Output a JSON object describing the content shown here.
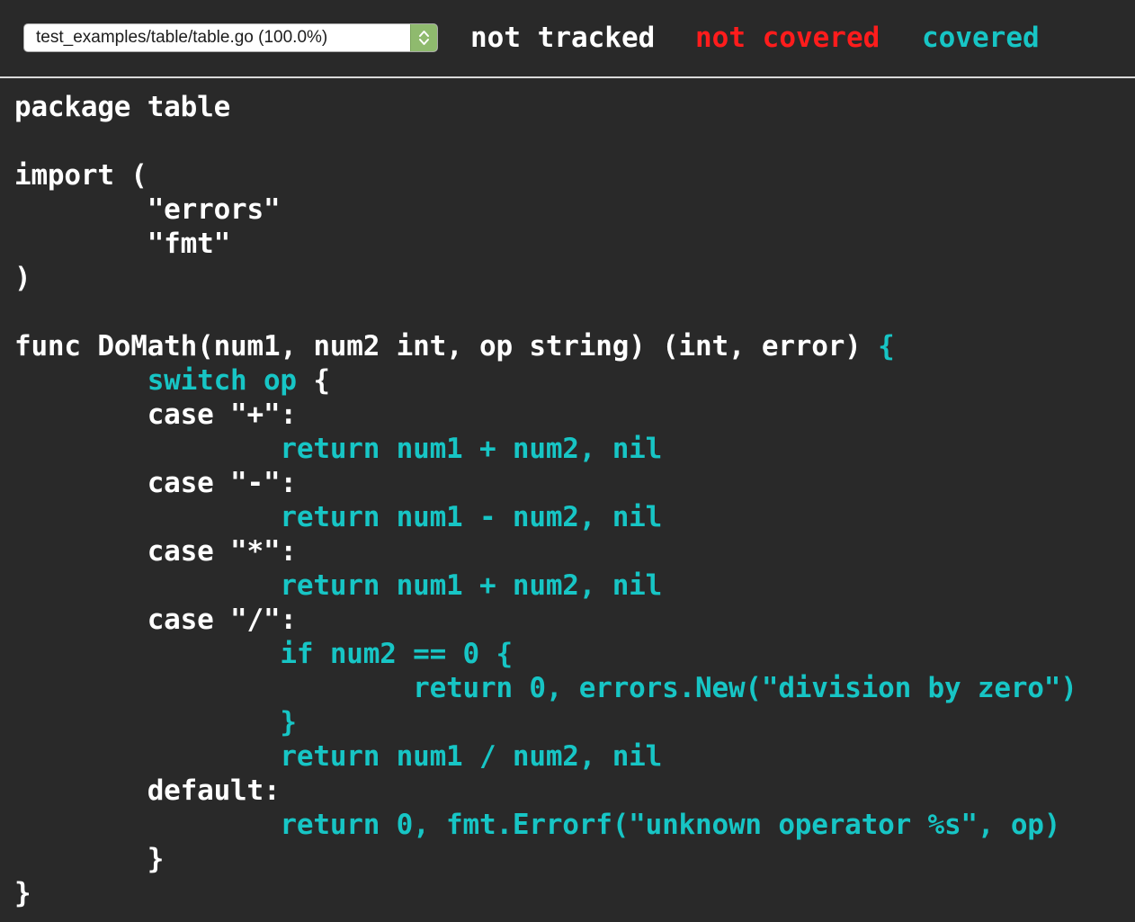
{
  "colors": {
    "background": "#292929",
    "not_tracked": "#ffffff",
    "not_covered": "#ff1c1c",
    "covered": "#17c5c5",
    "divider": "#d9d9d9",
    "select_stepper": "#8fba6e"
  },
  "topbar": {
    "file_select": {
      "selected": "test_examples/table/table.go (100.0%)",
      "icon": "up-down-chevron-icon"
    },
    "legend": {
      "not_tracked": "not tracked",
      "not_covered": "not covered",
      "covered": "covered"
    }
  },
  "source": {
    "lines": [
      {
        "segments": [
          {
            "text": "package table",
            "status": "not_tracked"
          }
        ]
      },
      {
        "segments": [
          {
            "text": "",
            "status": "not_tracked"
          }
        ]
      },
      {
        "segments": [
          {
            "text": "import (",
            "status": "not_tracked"
          }
        ]
      },
      {
        "segments": [
          {
            "text": "        \"errors\"",
            "status": "not_tracked"
          }
        ]
      },
      {
        "segments": [
          {
            "text": "        \"fmt\"",
            "status": "not_tracked"
          }
        ]
      },
      {
        "segments": [
          {
            "text": ")",
            "status": "not_tracked"
          }
        ]
      },
      {
        "segments": [
          {
            "text": "",
            "status": "not_tracked"
          }
        ]
      },
      {
        "segments": [
          {
            "text": "func DoMath(num1, num2 int, op string) (int, error) ",
            "status": "not_tracked"
          },
          {
            "text": "{",
            "status": "covered"
          }
        ]
      },
      {
        "segments": [
          {
            "text": "        ",
            "status": "not_tracked"
          },
          {
            "text": "switch op",
            "status": "covered"
          },
          {
            "text": " {",
            "status": "not_tracked"
          }
        ]
      },
      {
        "segments": [
          {
            "text": "        case \"+\":",
            "status": "not_tracked"
          }
        ]
      },
      {
        "segments": [
          {
            "text": "                ",
            "status": "not_tracked"
          },
          {
            "text": "return num1 + num2, nil",
            "status": "covered"
          }
        ]
      },
      {
        "segments": [
          {
            "text": "        case \"-\":",
            "status": "not_tracked"
          }
        ]
      },
      {
        "segments": [
          {
            "text": "                ",
            "status": "not_tracked"
          },
          {
            "text": "return num1 - num2, nil",
            "status": "covered"
          }
        ]
      },
      {
        "segments": [
          {
            "text": "        case \"*\":",
            "status": "not_tracked"
          }
        ]
      },
      {
        "segments": [
          {
            "text": "                ",
            "status": "not_tracked"
          },
          {
            "text": "return num1 + num2, nil",
            "status": "covered"
          }
        ]
      },
      {
        "segments": [
          {
            "text": "        case \"/\":",
            "status": "not_tracked"
          }
        ]
      },
      {
        "segments": [
          {
            "text": "                ",
            "status": "not_tracked"
          },
          {
            "text": "if num2 == 0 {",
            "status": "covered"
          }
        ]
      },
      {
        "segments": [
          {
            "text": "                        ",
            "status": "not_tracked"
          },
          {
            "text": "return 0, errors.New(\"division by zero\")",
            "status": "covered"
          }
        ]
      },
      {
        "segments": [
          {
            "text": "                ",
            "status": "not_tracked"
          },
          {
            "text": "}",
            "status": "covered"
          }
        ]
      },
      {
        "segments": [
          {
            "text": "                ",
            "status": "not_tracked"
          },
          {
            "text": "return num1 / num2, nil",
            "status": "covered"
          }
        ]
      },
      {
        "segments": [
          {
            "text": "        default:",
            "status": "not_tracked"
          }
        ]
      },
      {
        "segments": [
          {
            "text": "                ",
            "status": "not_tracked"
          },
          {
            "text": "return 0, fmt.Errorf(\"unknown operator %s\", op)",
            "status": "covered"
          }
        ]
      },
      {
        "segments": [
          {
            "text": "        }",
            "status": "not_tracked"
          }
        ]
      },
      {
        "segments": [
          {
            "text": "}",
            "status": "not_tracked"
          }
        ]
      }
    ]
  }
}
